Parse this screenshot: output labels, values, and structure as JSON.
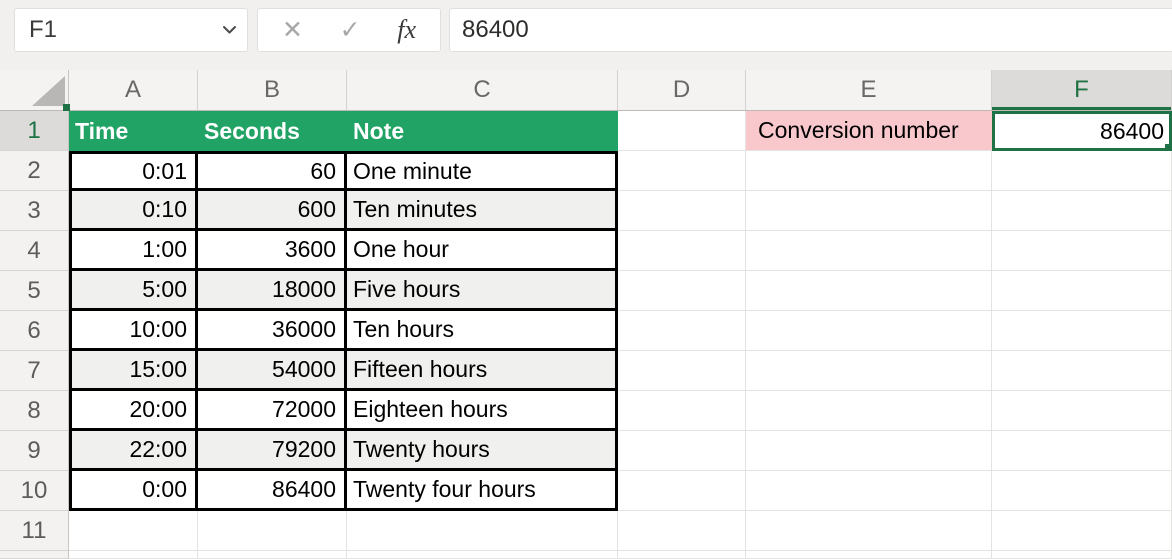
{
  "formula_bar": {
    "name_box": "F1",
    "formula": "86400",
    "cancel_icon": "✕",
    "enter_icon": "✓",
    "fx_icon": "fx"
  },
  "grid": {
    "columns": [
      "A",
      "B",
      "C",
      "D",
      "E",
      "F"
    ],
    "row_numbers": [
      "1",
      "2",
      "3",
      "4",
      "5",
      "6",
      "7",
      "8",
      "9",
      "10",
      "11"
    ],
    "selected_cell": "F1",
    "selected_column": "F",
    "selected_row": "1"
  },
  "sheet": {
    "header": {
      "time": "Time",
      "seconds": "Seconds",
      "note": "Note"
    },
    "conversion": {
      "label": "Conversion number",
      "value": "86400"
    },
    "rows": [
      {
        "time": "0:01",
        "seconds": "60",
        "note": "One minute"
      },
      {
        "time": "0:10",
        "seconds": "600",
        "note": "Ten minutes"
      },
      {
        "time": "1:00",
        "seconds": "3600",
        "note": "One hour"
      },
      {
        "time": "5:00",
        "seconds": "18000",
        "note": "Five hours"
      },
      {
        "time": "10:00",
        "seconds": "36000",
        "note": "Ten hours"
      },
      {
        "time": "15:00",
        "seconds": "54000",
        "note": "Fifteen hours"
      },
      {
        "time": "20:00",
        "seconds": "72000",
        "note": "Eighteen hours"
      },
      {
        "time": "22:00",
        "seconds": "79200",
        "note": "Twenty hours"
      },
      {
        "time": "0:00",
        "seconds": "86400",
        "note": "Twenty four hours"
      }
    ]
  },
  "colors": {
    "table_header_green": "#21A366",
    "selection_green": "#1F7245",
    "highlight_pink": "#F8C8CC",
    "band_gray": "#F0F0EF"
  }
}
